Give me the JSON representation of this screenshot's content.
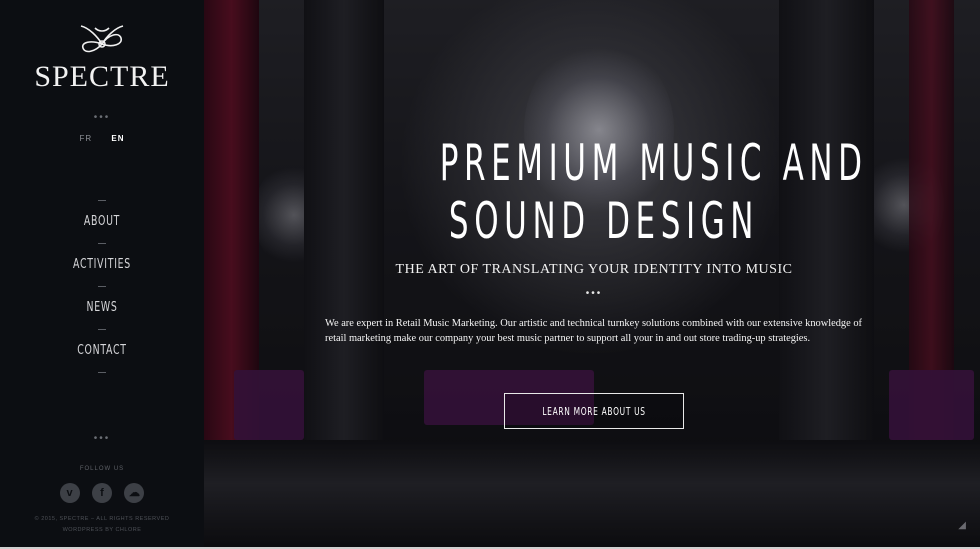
{
  "brand": {
    "name": "SPECTRE",
    "logo_icon": "ornamental-monogram-icon"
  },
  "languages": [
    {
      "label": "FR",
      "active": false
    },
    {
      "label": "EN",
      "active": true
    }
  ],
  "nav": {
    "items": [
      {
        "label": "About"
      },
      {
        "label": "Activities"
      },
      {
        "label": "News"
      },
      {
        "label": "Contact"
      }
    ]
  },
  "sidebar_dots": "•••",
  "follow": {
    "label": "FOLLOW US",
    "icons": [
      {
        "name": "vimeo-icon",
        "glyph": "v"
      },
      {
        "name": "facebook-icon",
        "glyph": "f"
      },
      {
        "name": "soundcloud-icon",
        "glyph": "☁"
      }
    ]
  },
  "footer": {
    "copyright": "© 2015, SPECTRE – ALL RIGHTS RESERVED",
    "credit": "WORDPRESS BY CHLORE"
  },
  "hero": {
    "title_line1": "PREMIUM MUSIC AND",
    "title_line2": "SOUND DESIGN",
    "subtitle": "THE ART OF TRANSLATING YOUR IDENTITY INTO MUSIC",
    "dots": "•••",
    "body": "We are expert in Retail Music Marketing. Our artistic and technical turnkey solutions combined with our extensive knowledge of retail marketing make our company your best music partner to support all your in and out store trading-up strategies.",
    "cta_label": "LEARN MORE ABOUT US"
  },
  "colors": {
    "sidebar_bg": "#0c0e12",
    "accent_purple": "#4a1650",
    "text_light": "#ffffff"
  }
}
